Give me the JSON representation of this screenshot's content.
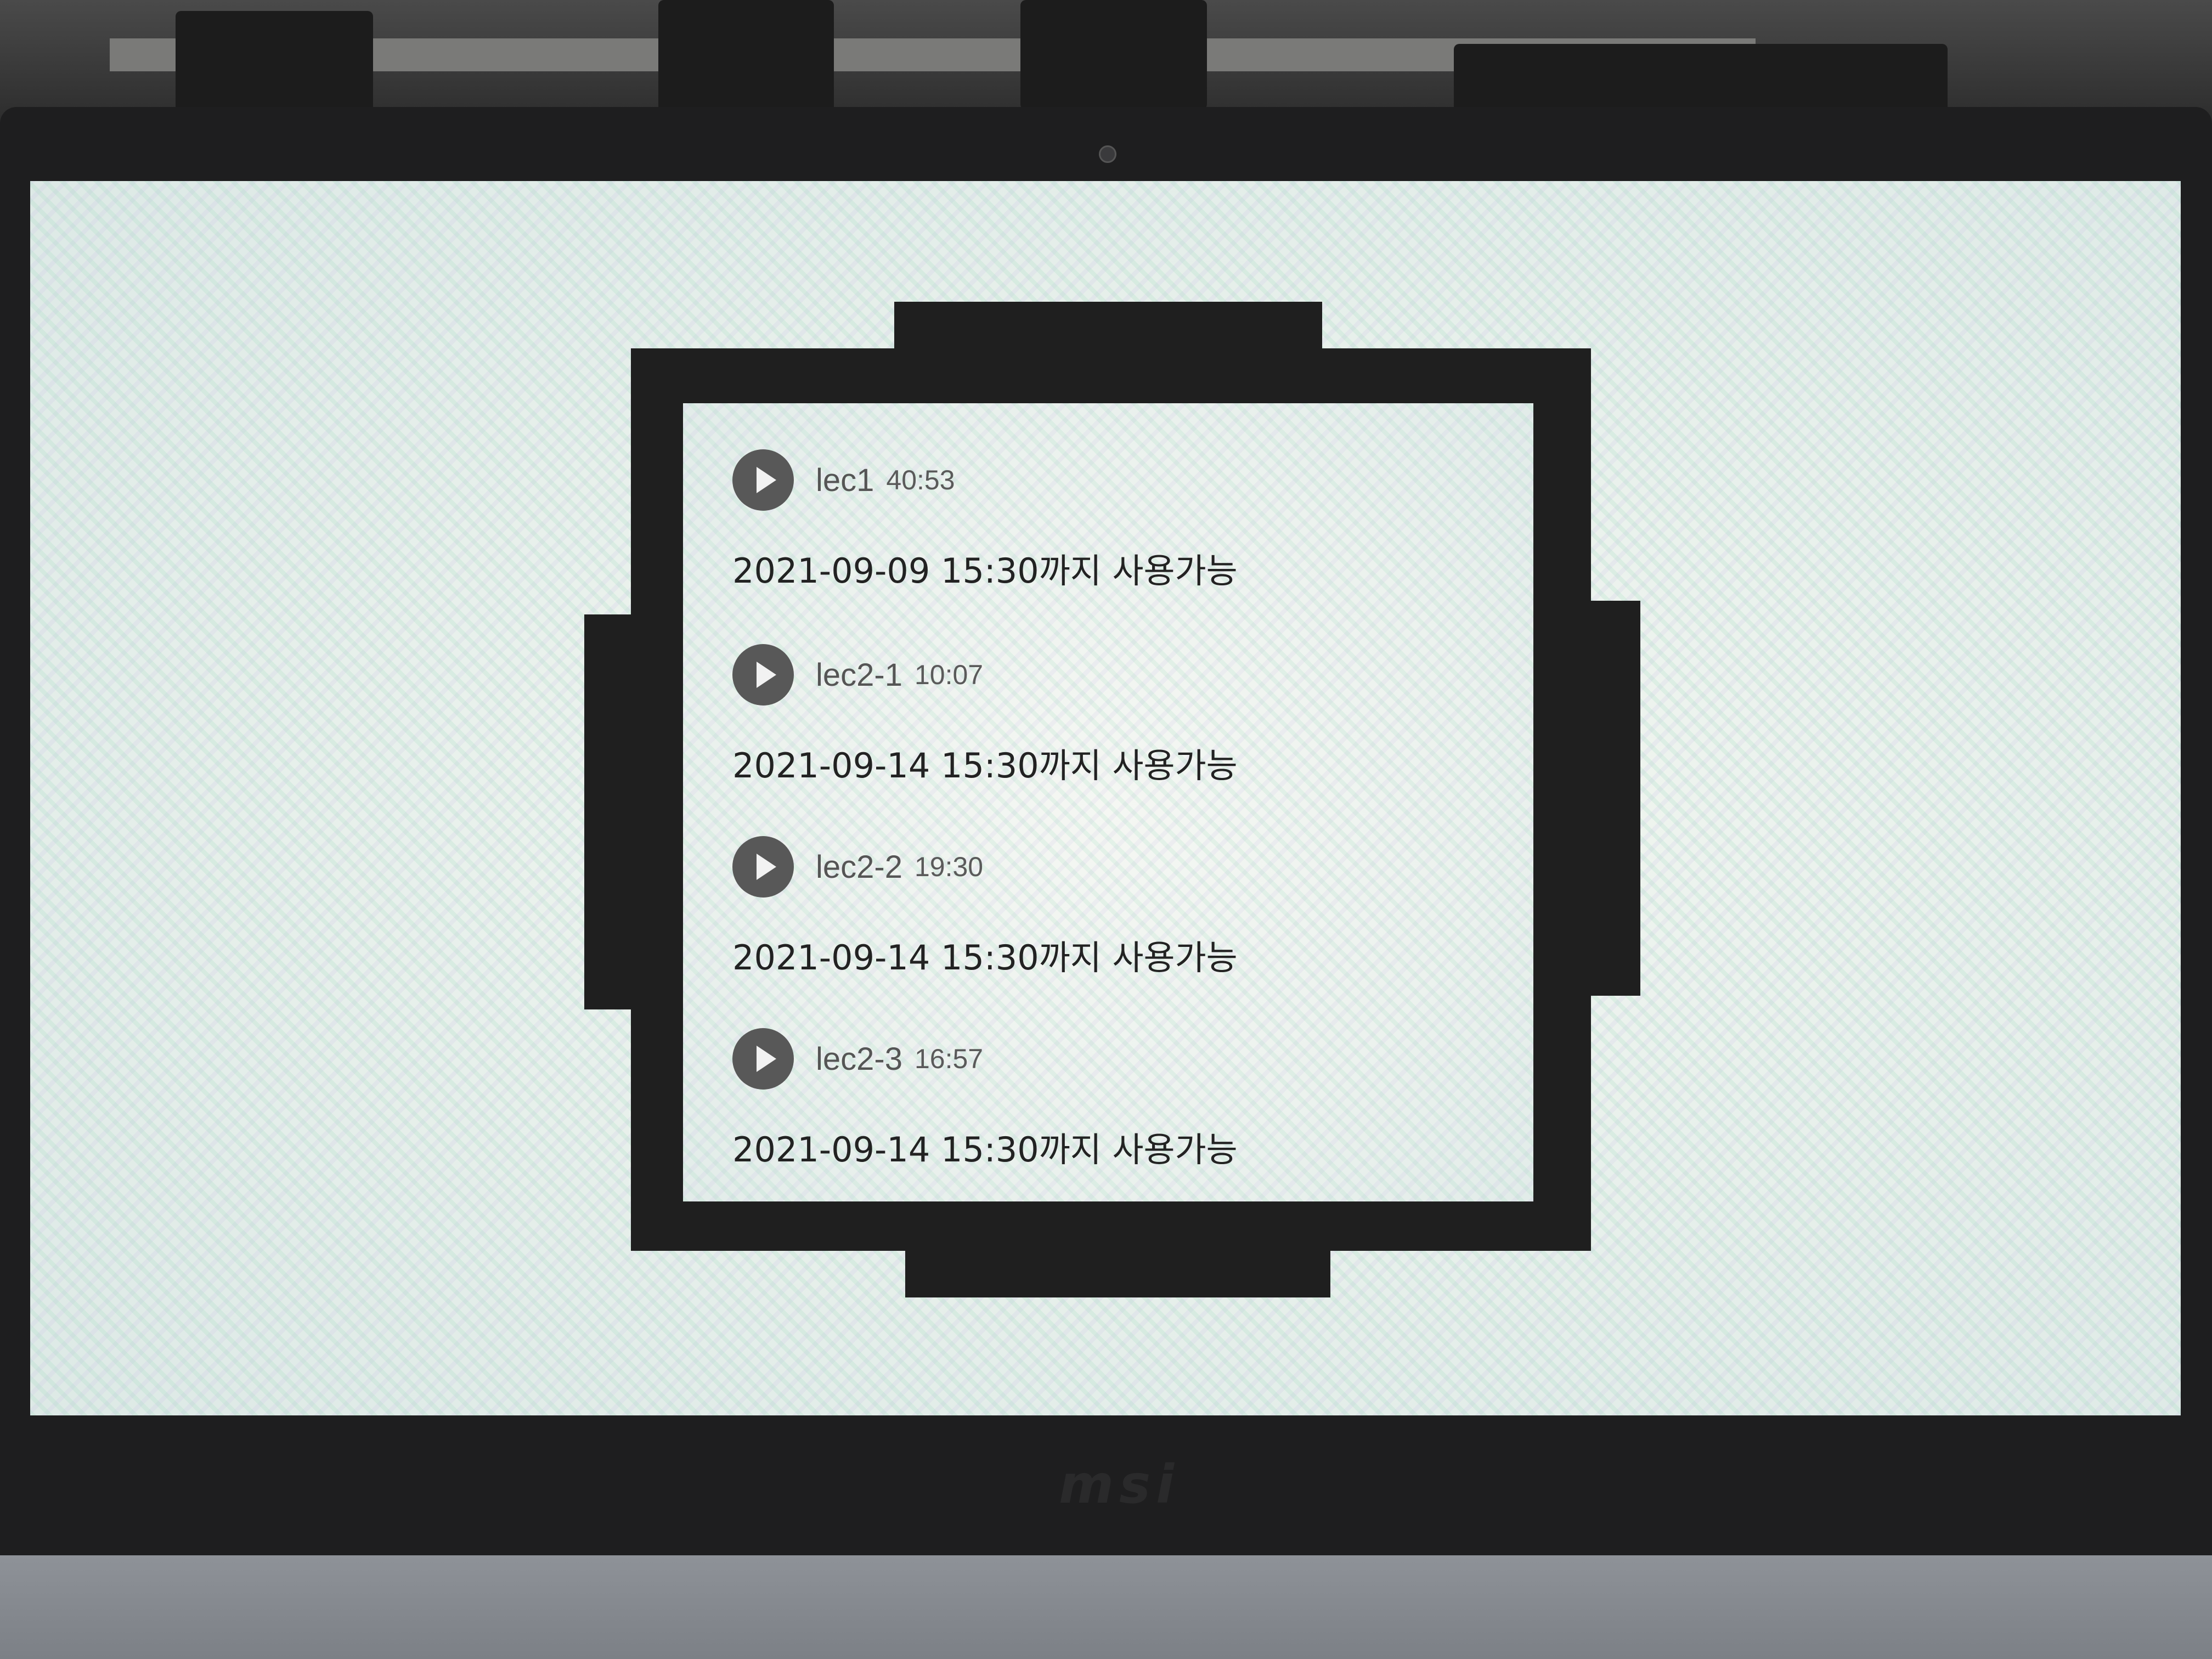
{
  "lectures": [
    {
      "name": "lec1",
      "duration": "40:53",
      "availability": "2021-09-09 15:30까지  사용가능"
    },
    {
      "name": "lec2-1",
      "duration": "10:07",
      "availability": "2021-09-14 15:30까지  사용가능"
    },
    {
      "name": "lec2-2",
      "duration": "19:30",
      "availability": "2021-09-14 15:30까지  사용가능"
    },
    {
      "name": "lec2-3",
      "duration": "16:57",
      "availability": "2021-09-14 15:30까지  사용가능"
    }
  ],
  "device": {
    "brand": "msi"
  },
  "icons": {
    "play": "play-icon"
  },
  "colors": {
    "frame": "#1f1f1f",
    "play_button": "#585858"
  }
}
